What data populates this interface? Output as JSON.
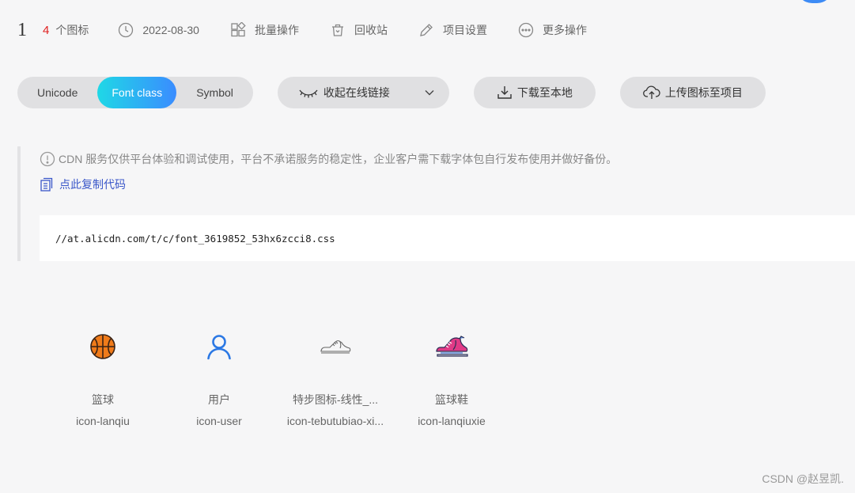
{
  "header": {
    "step": "1",
    "icon_count": "4",
    "icon_count_label": "个图标",
    "date": "2022-08-30",
    "batch": "批量操作",
    "recycle": "回收站",
    "settings": "项目设置",
    "more": "更多操作"
  },
  "tabs": {
    "unicode": "Unicode",
    "font_class": "Font class",
    "symbol": "Symbol",
    "active": "Font class"
  },
  "actions": {
    "collapse_link": "收起在线链接",
    "download": "下载至本地",
    "upload": "上传图标至项目"
  },
  "notice": {
    "cdn_text": "CDN 服务仅供平台体验和调试使用，平台不承诺服务的稳定性，企业客户需下载字体包自行发布使用并做好备份。",
    "copy_code": "点此复制代码",
    "css_url": "//at.alicdn.com/t/c/font_3619852_53hx6zcci8.css"
  },
  "icons": [
    {
      "name": "篮球",
      "code": "icon-lanqiu",
      "glyph": "basketball-icon"
    },
    {
      "name": "用户",
      "code": "icon-user",
      "glyph": "user-icon"
    },
    {
      "name": "特步图标-线性_...",
      "code": "icon-tebutubiao-xi...",
      "glyph": "sneaker-outline-icon"
    },
    {
      "name": "篮球鞋",
      "code": "icon-lanqiuxie",
      "glyph": "basketball-shoe-icon"
    }
  ],
  "watermark": "CSDN @赵昱凯.",
  "colors": {
    "accent_gradient_start": "#1fd8e6",
    "accent_gradient_end": "#3a8cff",
    "count_red": "#e02020",
    "link_blue": "#3a57c9",
    "basketball_orange": "#f07b1a",
    "user_blue": "#2b78e4"
  }
}
